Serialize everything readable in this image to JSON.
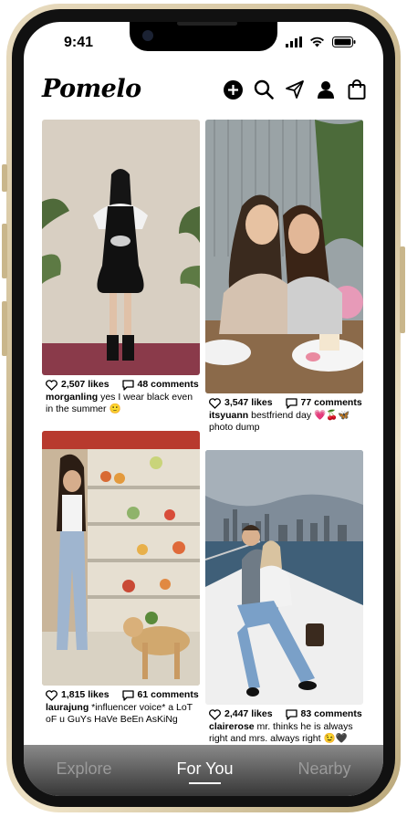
{
  "status": {
    "time": "9:41"
  },
  "brand": "Pomelo",
  "header_icons": [
    "add-icon",
    "search-icon",
    "send-icon",
    "profile-icon",
    "shopping-bag-icon"
  ],
  "posts": [
    {
      "likes": "2,507 likes",
      "comments": "48 comments",
      "user": "morganling",
      "caption": " yes I wear black even in the summer 🙂"
    },
    {
      "likes": "3,547 likes",
      "comments": "77 comments",
      "user": "itsyuann",
      "caption": " bestfriend day 💗🍒🦋 photo dump"
    },
    {
      "likes": "1,815 likes",
      "comments": "61 comments",
      "user": "laurajung",
      "caption": " *influencer voice* a LoT oF u GuYs HaVe BeEn AsKiNg"
    },
    {
      "likes": "2,447 likes",
      "comments": "83 comments",
      "user": "clairerose",
      "caption": " mr. thinks he is always right and mrs. always right 😉🖤"
    }
  ],
  "tabs": [
    {
      "label": "Explore"
    },
    {
      "label": "For You"
    },
    {
      "label": "Nearby"
    }
  ],
  "active_tab": "For You",
  "colors": {
    "accent": "#000000",
    "tab_inactive": "#9a9a9a",
    "tab_active": "#ffffff"
  }
}
